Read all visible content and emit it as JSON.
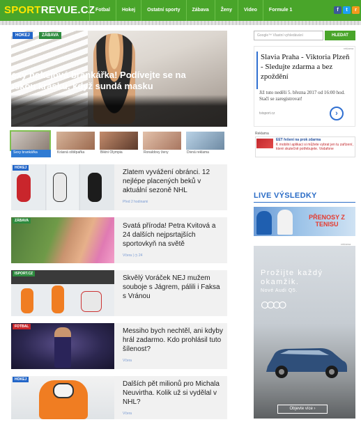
{
  "header": {
    "logo_sport": "SPORT",
    "logo_revue": "REVUE",
    "logo_cz": ".CZ",
    "nav": [
      "Fotbal",
      "Hokej",
      "Ostatní sporty",
      "Zábava",
      "Ženy",
      "Video",
      "Formule 1"
    ],
    "social": {
      "facebook": "f",
      "twitter": "t",
      "rss": "r"
    }
  },
  "hero": {
    "tags": [
      "HOKEJ",
      "ZÁBAVA"
    ],
    "title": "Sexy hokejová brankářka! Podívejte se na ruskou krásku, když sundá masku"
  },
  "thumbnails": [
    "Sexy brankářka",
    "Krásná oštěpařka",
    "Bikini Olympia",
    "Ronaldovy ženy",
    "Divná reklama"
  ],
  "articles": [
    {
      "tag": "HOKEJ",
      "title": "Zlatem vyvážení obránci. 12 nejlépe placených beků v aktuální sezoně NHL",
      "meta": "Před 2 hodinami"
    },
    {
      "tag": "ZÁBAVA",
      "title": "Svatá příroda! Petra Kvitová a 24 dalších nejpsrtajších sportovkyň na světě",
      "meta": "Včera | ◷ 24"
    },
    {
      "tag": "ISPORT.CZ",
      "title": "Skvělý Voráček NEJ mužem souboje s Jágrem, pálili i Faksa s Vránou",
      "meta": ""
    },
    {
      "tag": "FOTBAL",
      "title": "Messiho bych nechtěl, ani kdyby hrál zadarmo. Kdo prohlásil tuto šílenost?",
      "meta": "Včera"
    },
    {
      "tag": "HOKEJ",
      "title": "Dalších pět milionů pro Michala Neuvirtha. Kolik už si vydělal v NHL?",
      "meta": "Včera"
    }
  ],
  "search": {
    "placeholder": "Google™ Vlastní vyhledávání",
    "button": "HLEDAT"
  },
  "ad1": {
    "mark": "reklama",
    "headline": "Slavia Praha - Viktoria Plzeň - Sledujte zdarma a bez zpoždění",
    "body": "Již tuto neděli 5. března 2017 od 16:00 hod. Stačí se zaregistrovat!",
    "url": "tvisport.cz",
    "arrow": "›"
  },
  "ad2": {
    "label": "Reklama",
    "title": "EET řešení na prok zdarma",
    "text": "K mobilní aplikaci si můžete vybrat jen tu zařízení, které skutečně potřebujete. Vodafone"
  },
  "live": {
    "title": "LIVE VÝSLEDKY",
    "banner": "PŘENOSY Z TENISU"
  },
  "audi": {
    "mark": "reklama",
    "headline": "Prožijte každý okamžik.",
    "sub": "Nové Audi Q5.",
    "cta": "Objevte více ›"
  },
  "colors": {
    "brand_green": "#49a52a",
    "accent_blue": "#2a6cc6",
    "logo_yellow": "#ffe600"
  }
}
